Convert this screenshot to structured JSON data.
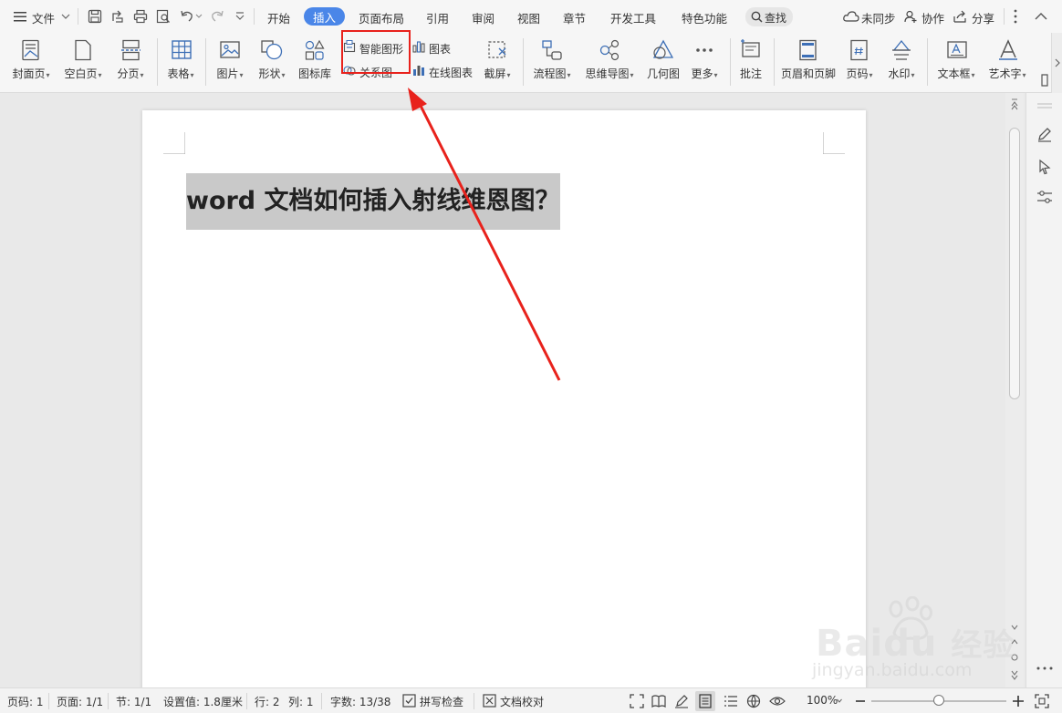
{
  "titlebar": {
    "menu_label": "文件",
    "tabs": [
      "开始",
      "插入",
      "页面布局",
      "引用",
      "审阅",
      "视图",
      "章节",
      "开发工具",
      "特色功能"
    ],
    "search_label": "查找",
    "sync_label": "未同步",
    "collab_label": "协作",
    "share_label": "分享"
  },
  "ribbon": {
    "cover": "封面页",
    "blank": "空白页",
    "pagebreak": "分页",
    "table": "表格",
    "picture": "图片",
    "shape": "形状",
    "iconlib": "图标库",
    "smartart": "智能图形",
    "relation": "关系图",
    "chart": "图表",
    "onlinechart": "在线图表",
    "screenshot": "截屏",
    "flowchart": "流程图",
    "mindmap": "思维导图",
    "geometry": "几何图",
    "more": "更多",
    "comment": "批注",
    "headerfooter": "页眉和页脚",
    "pagenum": "页码",
    "watermark": "水印",
    "textbox": "文本框",
    "wordart": "艺术字"
  },
  "document": {
    "heading": "word 文档如何插入射线维恩图？"
  },
  "status": {
    "pagenum": "页码: 1",
    "pages": "页面: 1/1",
    "section": "节: 1/1",
    "setting": "设置值: 1.8厘米",
    "row": "行: 2",
    "col": "列: 1",
    "wordcount": "字数: 13/38",
    "spellcheck": "拼写检查",
    "proofread": "文档校对",
    "zoom": "100%"
  },
  "watermark": {
    "brand": "Bai",
    "brand_cn": "经验",
    "url": "jingyan.baidu.com"
  },
  "annotation": {
    "box_color": "#e8221c",
    "arrow_color": "#e8221c"
  },
  "colors": {
    "accent": "#4a86e8",
    "icon": "#3d6fb6"
  }
}
